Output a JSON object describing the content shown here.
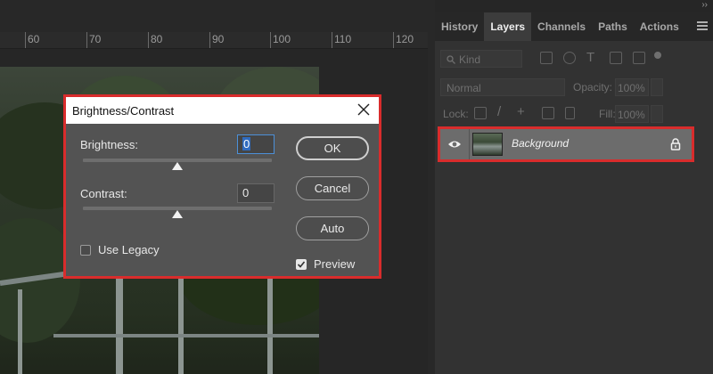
{
  "ruler": {
    "ticks": [
      "60",
      "70",
      "80",
      "90",
      "100",
      "110",
      "120"
    ]
  },
  "panel": {
    "collapse_glyph": "››",
    "tabs": [
      "History",
      "Layers",
      "Channels",
      "Paths",
      "Actions"
    ],
    "active_tab": "Layers",
    "filter": {
      "kind_label": "Kind"
    },
    "blend_mode": "Normal",
    "opacity_label": "Opacity:",
    "opacity_value": "100%",
    "lock_label": "Lock:",
    "fill_label": "Fill:",
    "fill_value": "100%",
    "layer": {
      "name": "Background",
      "visible": true,
      "locked": true
    }
  },
  "dialog": {
    "title": "Brightness/Contrast",
    "brightness_label": "Brightness:",
    "brightness_value": "0",
    "contrast_label": "Contrast:",
    "contrast_value": "0",
    "brightness_slider_fraction": 0.5,
    "contrast_slider_fraction": 0.5,
    "use_legacy_label": "Use Legacy",
    "use_legacy_checked": false,
    "preview_label": "Preview",
    "preview_checked": true,
    "ok_label": "OK",
    "cancel_label": "Cancel",
    "auto_label": "Auto"
  },
  "colors": {
    "highlight_border": "#d92c2c",
    "focus_blue": "#4c90d8"
  }
}
